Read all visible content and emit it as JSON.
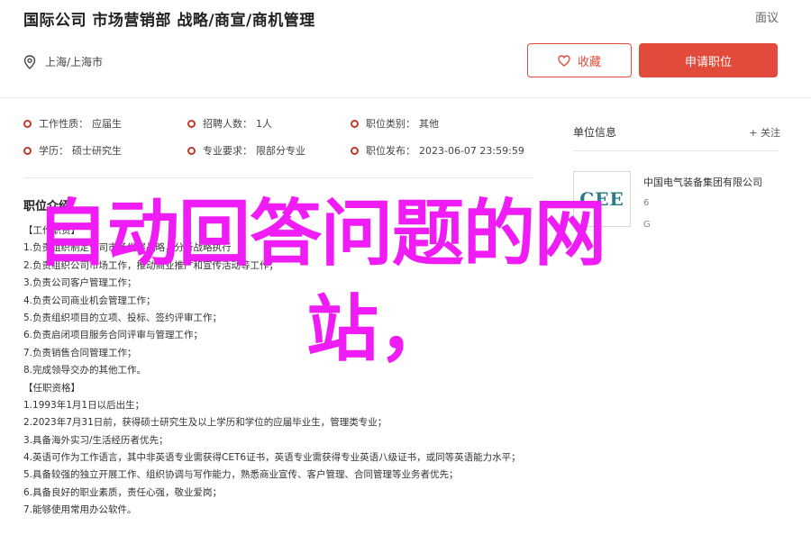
{
  "header": {
    "job_title": "国际公司 市场营销部 战略/商宣/商机管理",
    "report": "面议",
    "location": "上海/上海市",
    "fav_label": "收藏",
    "apply_label": "申请职位"
  },
  "info": [
    [
      {
        "label": "工作性质：",
        "value": "应届生"
      },
      {
        "label": "招聘人数：",
        "value": "1人"
      },
      {
        "label": "职位类别：",
        "value": "其他"
      }
    ],
    [
      {
        "label": "学历：",
        "value": "硕士研究生"
      },
      {
        "label": "专业要求：",
        "value": "限部分专业"
      },
      {
        "label": "职位发布：",
        "value": "2023-06-07 23:59:59"
      }
    ]
  ],
  "description": {
    "title": "职位介绍",
    "lines": [
      "【工作职责】",
      "1.负责组织制定公司市场发展战略，分析战略执行",
      "2.负责组织公司市场工作，推动商业推广和宣传活动等工作；",
      "3.负责公司客户管理工作；",
      "4.负责公司商业机会管理工作；",
      "5.负责组织项目的立项、投标、签约评审工作；",
      "6.负责启闭项目服务合同评审与管理工作；",
      "7.负责销售合同管理工作；",
      "8.完成领导交办的其他工作。",
      "【任职资格】",
      "1.1993年1月1日以后出生；",
      "2.2023年7月31日前，获得硕士研究生及以上学历和学位的应届毕业生，管理类专业；",
      "3.具备海外实习/生活经历者优先；",
      "4.英语可作为工作语言，其中非英语专业需获得CET6证书，英语专业需获得专业英语八级证书，或同等英语能力水平；",
      "5.具备较强的独立开展工作、组织协调与写作能力，熟悉商业宣传、客户管理、合同管理等业务者优先；",
      "6.具备良好的职业素质，责任心强，敬业爱岗；",
      "7.能够使用常用办公软件。"
    ]
  },
  "side": {
    "title": "单位信息",
    "more": "+ 关注",
    "company_name": "中国电气装备集团有限公司",
    "logo_text": "CEE",
    "meta1": "6",
    "meta2": "G"
  },
  "overlay": {
    "line1": "自动回答问题的网",
    "line2": "站，"
  },
  "colors": {
    "accent": "#e24b3b",
    "overlay": "#f01cf5"
  }
}
